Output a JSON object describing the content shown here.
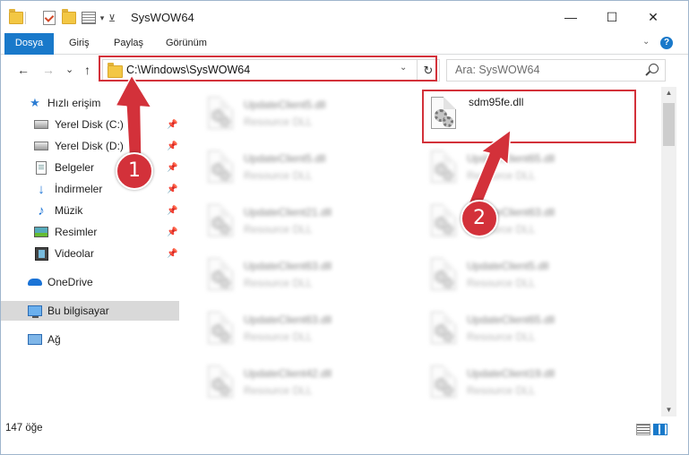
{
  "window": {
    "title": "SysWOW64"
  },
  "caption_buttons": {
    "minimize": "—",
    "maximize": "☐",
    "close": "✕"
  },
  "ribbon": {
    "tabs": [
      {
        "label": "Dosya"
      },
      {
        "label": "Giriş"
      },
      {
        "label": "Paylaş"
      },
      {
        "label": "Görünüm"
      }
    ],
    "help": "?"
  },
  "navigation": {
    "back": "←",
    "forward": "→",
    "recent": "⌄",
    "up": "↑",
    "address": "C:\\Windows\\SysWOW64",
    "refresh": "↻",
    "search_placeholder": "Ara: SysWOW64"
  },
  "sidebar": {
    "items": [
      {
        "label": "Hızlı erişim",
        "icon": "star-icon"
      },
      {
        "label": "Yerel Disk (C:)",
        "icon": "drive-icon",
        "pinned": true
      },
      {
        "label": "Yerel Disk (D:)",
        "icon": "drive-icon",
        "pinned": true
      },
      {
        "label": "Belgeler",
        "icon": "documents-icon",
        "pinned": true
      },
      {
        "label": "İndirmeler",
        "icon": "downloads-icon",
        "pinned": true
      },
      {
        "label": "Müzik",
        "icon": "music-icon",
        "pinned": true
      },
      {
        "label": "Resimler",
        "icon": "pictures-icon",
        "pinned": true
      },
      {
        "label": "Videolar",
        "icon": "videos-icon",
        "pinned": true
      },
      {
        "label": "OneDrive",
        "icon": "cloud-icon"
      },
      {
        "label": "Bu bilgisayar",
        "icon": "computer-icon",
        "selected": true
      },
      {
        "label": "Ağ",
        "icon": "network-icon"
      }
    ]
  },
  "files": {
    "left_column": [
      {
        "name": "UpdateClient5.dll",
        "type": "Resource DLL"
      },
      {
        "name": "UpdateClient5.dll",
        "type": "Resource DLL"
      },
      {
        "name": "UpdateClient21.dll",
        "type": "Resource DLL"
      },
      {
        "name": "UpdateClient63.dll",
        "type": "Resource DLL"
      },
      {
        "name": "UpdateClient63.dll",
        "type": "Resource DLL"
      },
      {
        "name": "UpdateClient42.dll",
        "type": "Resource DLL"
      }
    ],
    "right_column": [
      {
        "name": "sdm95fe.dll",
        "type": "",
        "highlighted": true
      },
      {
        "name": "UpdateClient65.dll",
        "type": "Resource DLL"
      },
      {
        "name": "UpdateClient63.dll",
        "type": "Resource DLL"
      },
      {
        "name": "UpdateClient5.dll",
        "type": "Resource DLL"
      },
      {
        "name": "UpdateClient65.dll",
        "type": "Resource DLL"
      },
      {
        "name": "UpdateClient19.dll",
        "type": "Resource DLL"
      }
    ]
  },
  "status": {
    "item_count": "147 öğe"
  },
  "annotations": {
    "badge_1": "1",
    "badge_2": "2"
  },
  "colors": {
    "accent": "#1979ca",
    "annotation_red": "#d3313a"
  }
}
